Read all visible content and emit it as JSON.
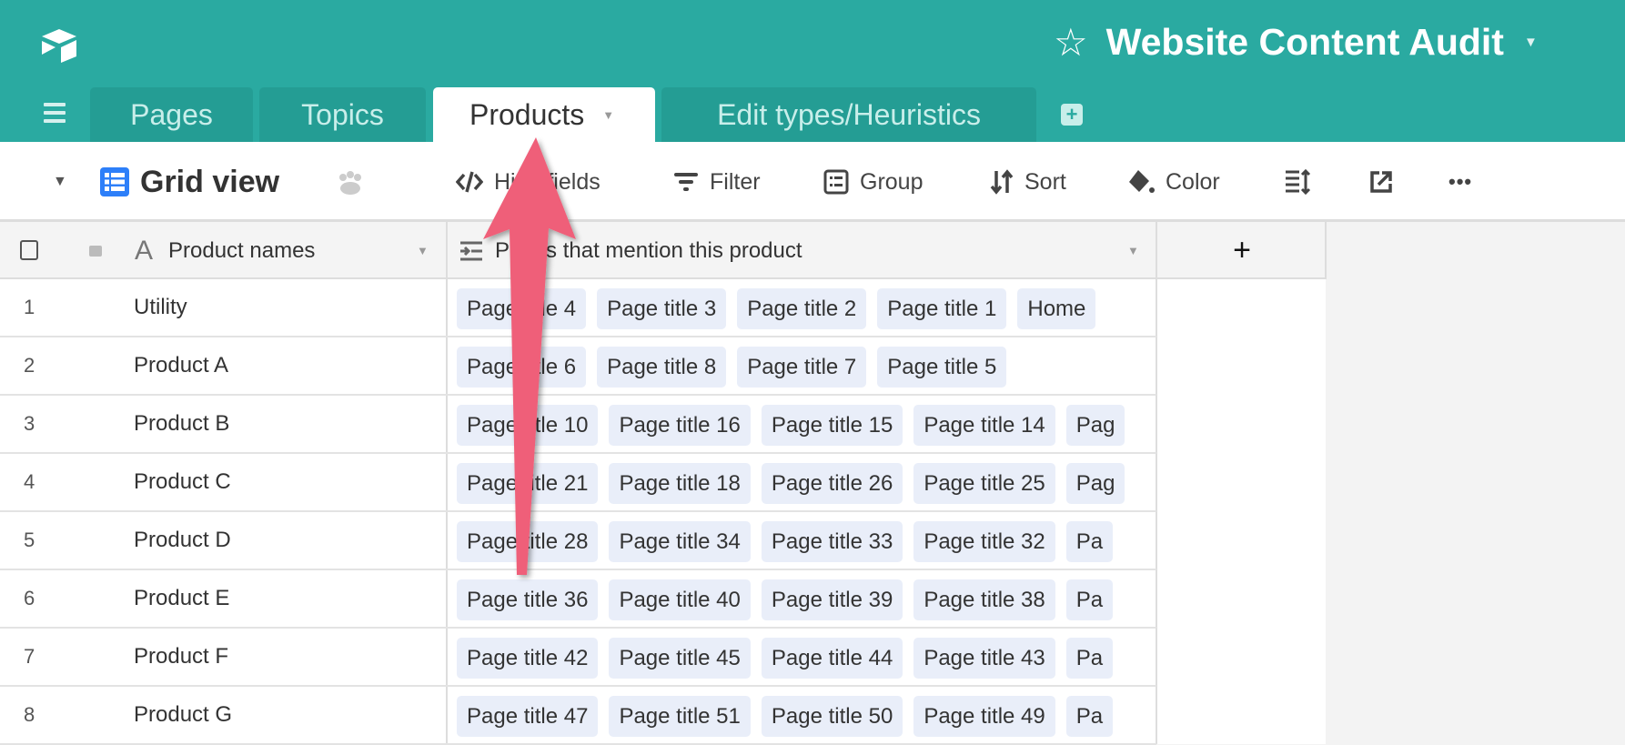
{
  "app": {
    "title": "Website Content Audit",
    "brand_color": "#2aaaa1",
    "logo": "airtable-logo"
  },
  "tabs": [
    {
      "label": "Pages",
      "active": false
    },
    {
      "label": "Topics",
      "active": false
    },
    {
      "label": "Products",
      "active": true
    },
    {
      "label": "Edit types/Heuristics",
      "active": false
    }
  ],
  "toolbar": {
    "view_name": "Grid view",
    "hide_fields": "Hide fields",
    "filter": "Filter",
    "group": "Group",
    "sort": "Sort",
    "color": "Color"
  },
  "columns": [
    {
      "label": "Product names",
      "icon": "text-icon"
    },
    {
      "label": "Pages that mention this product",
      "icon": "link-icon"
    }
  ],
  "rows": [
    {
      "n": "1",
      "name": "Utility",
      "pages": [
        "Page title 4",
        "Page title 3",
        "Page title 2",
        "Page title 1",
        "Home"
      ]
    },
    {
      "n": "2",
      "name": "Product A",
      "pages": [
        "Page title 6",
        "Page title 8",
        "Page title 7",
        "Page title 5"
      ]
    },
    {
      "n": "3",
      "name": "Product B",
      "pages": [
        "Page title 10",
        "Page title 16",
        "Page title 15",
        "Page title 14",
        "Pag"
      ]
    },
    {
      "n": "4",
      "name": "Product C",
      "pages": [
        "Page title 21",
        "Page title 18",
        "Page title 26",
        "Page title 25",
        "Pag"
      ]
    },
    {
      "n": "5",
      "name": "Product D",
      "pages": [
        "Page title 28",
        "Page title 34",
        "Page title 33",
        "Page title 32",
        "Pa"
      ]
    },
    {
      "n": "6",
      "name": "Product E",
      "pages": [
        "Page title 36",
        "Page title 40",
        "Page title 39",
        "Page title 38",
        "Pa"
      ]
    },
    {
      "n": "7",
      "name": "Product F",
      "pages": [
        "Page title 42",
        "Page title 45",
        "Page title 44",
        "Page title 43",
        "Pa"
      ]
    },
    {
      "n": "8",
      "name": "Product G",
      "pages": [
        "Page title 47",
        "Page title 51",
        "Page title 50",
        "Page title 49",
        "Pa"
      ]
    }
  ],
  "annotation": {
    "type": "arrow",
    "color": "#ef5f79",
    "points_to": "Products tab"
  }
}
